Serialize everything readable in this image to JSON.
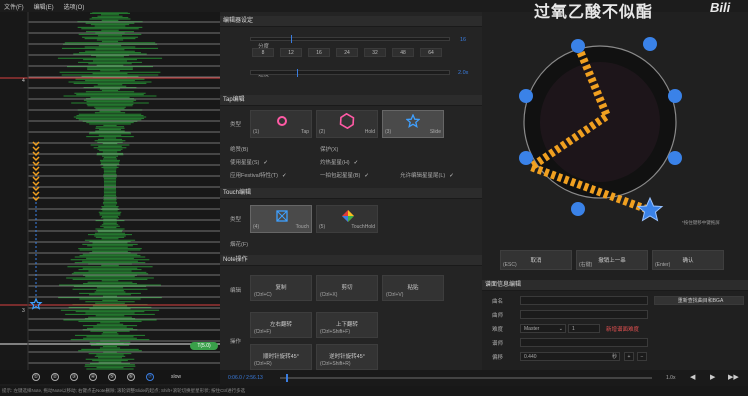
{
  "menu": [
    "文件(F)",
    "编辑(E)",
    "选项(O)"
  ],
  "timeline": {
    "marker_top": "4",
    "marker_bottom": "3",
    "badge": "T(5.0)",
    "toolbar_buttons": [
      "①",
      "②",
      "③",
      "④",
      "⑤",
      "⑥",
      "⑦"
    ],
    "mode_icon": "slow"
  },
  "editor_settings": {
    "title": "编辑器设定",
    "division_label": "分度",
    "division_value": "16",
    "division_ticks": [
      "8",
      "12",
      "16",
      "24",
      "32",
      "48",
      "64"
    ],
    "speed_label": "速度",
    "speed_value": "2.0x"
  },
  "tap": {
    "title": "Tap编辑",
    "type_label": "类型",
    "types": [
      {
        "key": "(1)",
        "name": "Tap"
      },
      {
        "key": "(2)",
        "name": "Hold"
      },
      {
        "key": "(3)",
        "name": "Slide"
      }
    ],
    "checks": [
      {
        "label": "绝赞(B)",
        "checked": ""
      },
      {
        "label": "保护(X)",
        "checked": ""
      },
      {
        "label": "使用星星(S)",
        "checked": "✓"
      },
      {
        "label": "灼热星星(H)",
        "checked": "✓"
      },
      {
        "label": "应用Festival特性(T)",
        "checked": "✓"
      },
      {
        "label": "一拍包起星星(B)",
        "checked": "✓"
      },
      {
        "label": "允许编辑星星尾(L)",
        "checked": "✓"
      }
    ]
  },
  "touch": {
    "title": "Touch编辑",
    "type_label": "类型",
    "types": [
      {
        "key": "(4)",
        "name": "Touch"
      },
      {
        "key": "(5)",
        "name": "TouchHold"
      }
    ],
    "firework_label": "烟花(F)"
  },
  "note_ops": {
    "title": "Note操作",
    "edit_label": "编辑",
    "rotate_label": "操作",
    "buttons": [
      {
        "name": "复制",
        "key": "(Ctrl+C)"
      },
      {
        "name": "剪切",
        "key": "(Ctrl+X)"
      },
      {
        "name": "粘贴",
        "key": "(Ctrl+V)"
      },
      {
        "name": "左右翻转",
        "key": "(Ctrl+F)"
      },
      {
        "name": "上下翻转",
        "key": "(Ctrl+Shift+F)"
      },
      {
        "name": "顺时针旋转45°",
        "key": "(Ctrl+R)"
      },
      {
        "name": "逆时针旋转45°",
        "key": "(Ctrl+Shift+R)"
      }
    ]
  },
  "preview": {
    "title_text": "过氧乙酸不似酯",
    "corner_logo": "Bili",
    "hint": "*按住键移中键拖屏"
  },
  "action_buttons": [
    {
      "name": "取消",
      "key": "(ESC)"
    },
    {
      "name": "撤销上一串",
      "key": "(右键)"
    },
    {
      "name": "确认",
      "key": "(Enter)"
    }
  ],
  "chart_info": {
    "title": "谱面信息编辑",
    "title_label": "曲名",
    "artist_label": "曲师",
    "difficulty_label": "难度",
    "difficulty_value": "Master",
    "level_value": "1",
    "designer_label": "谱师",
    "offset_label": "偏移",
    "offset_value": "0.440",
    "offset_unit": "秒",
    "bga_button": "重新查找曲目和BGA",
    "highlight_text": "新增谱面难度"
  },
  "playback": {
    "time": "0:06.0 / 2:56.13"
  },
  "status_text": "提示: 左键选择Note, 拖动Note以移动; 右键点击Note删除; 滚轮调整Slide的起点; Shift+滚轮切换星星形状; 按住Ctrl进行多选",
  "colors": {
    "accent": "#3a7de0",
    "wave": "#2aa83a",
    "slide_arrow": "#f0a020"
  }
}
